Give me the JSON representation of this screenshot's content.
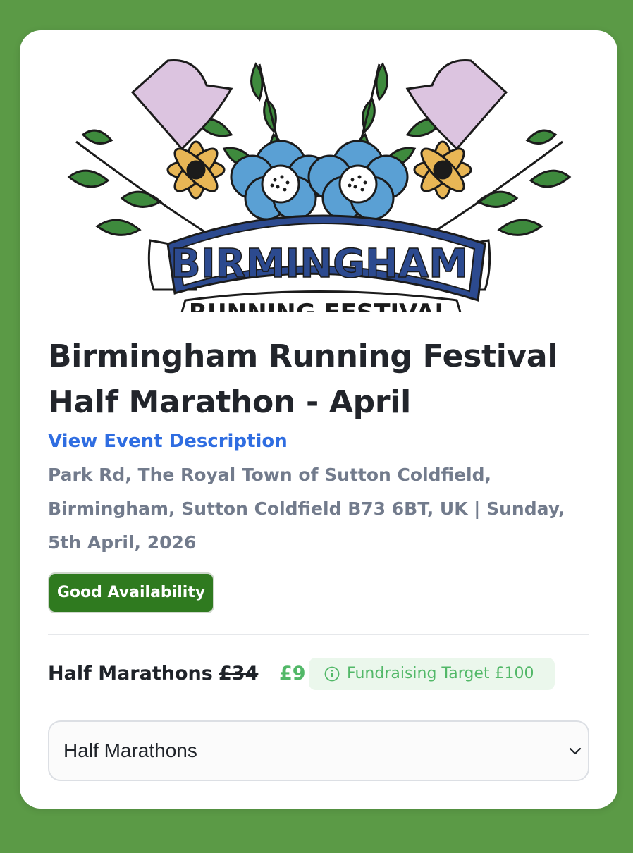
{
  "event": {
    "title_lines": [
      "Birmingham Running Festival",
      "Half Marathon - April"
    ],
    "description_link": "View Event Description",
    "location_lines": [
      "Park Rd, The Royal Town of Sutton Coldfield,",
      "Birmingham, Sutton Coldfield B73 6BT, UK | Sunday,",
      "5th April, 2026"
    ],
    "availability": "Good Availability"
  },
  "logo": {
    "banner_text": "BIRMINGHAM",
    "sub_text": "RUNNING FESTIVAL"
  },
  "pricing": {
    "label": "Half Marathons :",
    "old_price": "£34",
    "new_price": "£9",
    "fundraising": "Fundraising Target £100"
  },
  "ticket_select": {
    "selected": "Half Marathons"
  },
  "colors": {
    "background": "#5b9a46",
    "link": "#2f6de1",
    "badge": "#2f7a1f",
    "price_green": "#52b868",
    "banner_blue": "#2c4a8f",
    "flower_blue": "#5aa0d4",
    "flower_yellow": "#e8b655",
    "flower_pink": "#dcc4e0",
    "leaf_green": "#3e8a3d"
  }
}
